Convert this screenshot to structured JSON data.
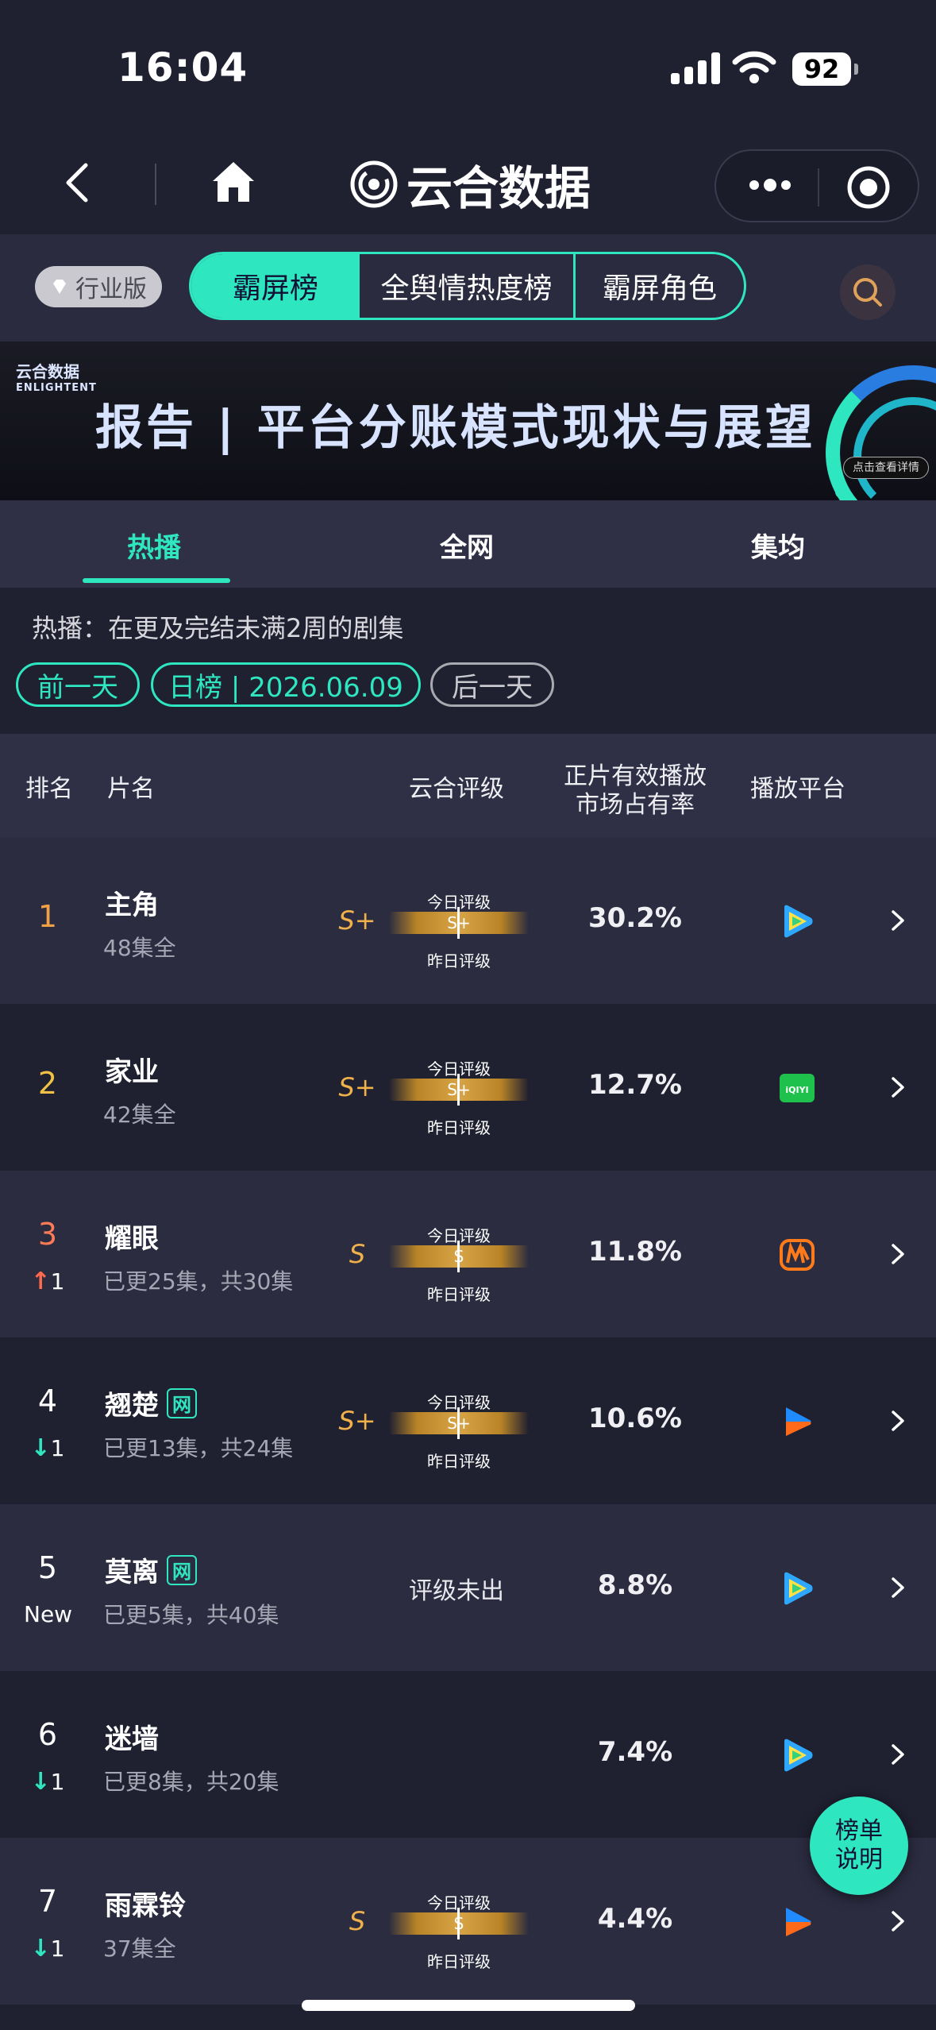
{
  "status_bar": {
    "time": "16:04",
    "battery": "92"
  },
  "navbar": {
    "title": "云合数据"
  },
  "topbar": {
    "industry_label": "行业版",
    "segments": [
      "霸屏榜",
      "全舆情热度榜",
      "霸屏角色"
    ]
  },
  "banner": {
    "brand": "云合数据",
    "brand_en": "ENLIGHTENT",
    "headline": "报告 | 平台分账模式现状与展望",
    "detail_button": "点击查看详情"
  },
  "category_tabs": [
    "热播",
    "全网",
    "集均"
  ],
  "info": {
    "description": "热播：在更及完结未满2周的剧集",
    "prev_day": "前一天",
    "date_label": "日榜 | 2026.06.09",
    "next_day": "后一天"
  },
  "table_header": {
    "rank": "排名",
    "name": "片名",
    "grade": "云合评级",
    "share_line1": "正片有效播放",
    "share_line2": "市场占有率",
    "platform": "播放平台"
  },
  "grade_labels": {
    "today": "今日评级",
    "yesterday": "昨日评级"
  },
  "rows": [
    {
      "rank": "1",
      "change": "",
      "change_dir": "",
      "title": "主角",
      "net": false,
      "sub": "48集全",
      "grade": "S+",
      "grade_bar": "S+",
      "share": "30.2%",
      "platform": "tencent-video-icon",
      "rank_color": "#f0a146"
    },
    {
      "rank": "2",
      "change": "",
      "change_dir": "",
      "title": "家业",
      "net": false,
      "sub": "42集全",
      "grade": "S+",
      "grade_bar": "S+",
      "share": "12.7%",
      "platform": "iqiyi-icon",
      "rank_color": "#f0c146"
    },
    {
      "rank": "3",
      "change": "1",
      "change_dir": "up",
      "title": "耀眼",
      "net": false,
      "sub": "已更25集，共30集",
      "grade": "S",
      "grade_bar": "S",
      "share": "11.8%",
      "platform": "mango-tv-icon",
      "rank_color": "#ff7b57"
    },
    {
      "rank": "4",
      "change": "1",
      "change_dir": "down",
      "title": "翘楚",
      "net": true,
      "sub": "已更13集，共24集",
      "grade": "S+",
      "grade_bar": "S+",
      "share": "10.6%",
      "platform": "youku-icon",
      "rank_color": "#ffffff"
    },
    {
      "rank": "5",
      "change": "New",
      "change_dir": "new",
      "title": "莫离",
      "net": true,
      "sub": "已更5集，共40集",
      "grade": "",
      "grade_bar": "",
      "no_grade": "评级未出",
      "share": "8.8%",
      "platform": "tencent-video-icon",
      "rank_color": "#ffffff"
    },
    {
      "rank": "6",
      "change": "1",
      "change_dir": "down",
      "title": "迷墙",
      "net": false,
      "sub": "已更8集，共20集",
      "grade": "",
      "grade_bar": "",
      "share": "7.4%",
      "platform": "tencent-video-icon",
      "rank_color": "#ffffff"
    },
    {
      "rank": "7",
      "change": "1",
      "change_dir": "down",
      "title": "雨霖铃",
      "net": false,
      "sub": "37集全",
      "grade": "S",
      "grade_bar": "S",
      "share": "4.4%",
      "platform": "youku-icon",
      "rank_color": "#ffffff"
    }
  ],
  "net_badge": "网",
  "floating_button": {
    "line1": "榜单",
    "line2": "说明"
  },
  "colors": {
    "accent": "#2ee6c0",
    "gold": "#f0b14a",
    "up": "#ff6a4d"
  }
}
